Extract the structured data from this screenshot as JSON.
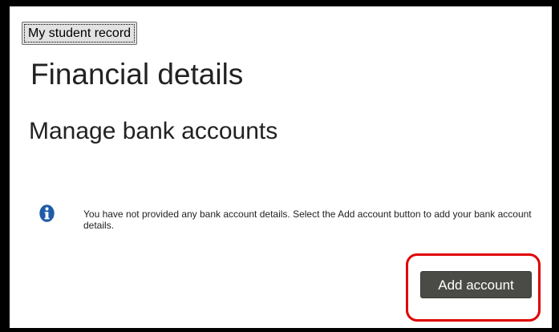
{
  "header": {
    "record_button_label": "My student record"
  },
  "page": {
    "title": "Financial details",
    "section_title": "Manage bank accounts"
  },
  "notice": {
    "icon": "info-icon",
    "text": "You have not provided any bank account details. Select the Add account button to add your bank account details."
  },
  "actions": {
    "add_account_label": "Add account"
  },
  "colors": {
    "info_icon": "#1f5ca8",
    "button_background": "#4a4a46",
    "highlight": "#e00000"
  }
}
